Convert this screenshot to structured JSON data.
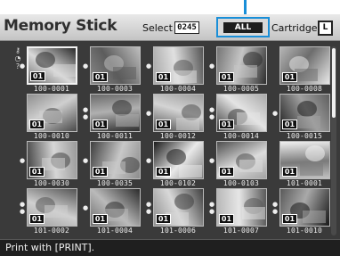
{
  "header": {
    "title": "Memory Stick",
    "select_label": "Select",
    "select_count": "0245",
    "all_label": "ALL",
    "cartridge_label": "Cartridge",
    "cartridge_icon_label": "L"
  },
  "side_icons": "◔ ? ?",
  "thumbnails": [
    {
      "name": "100-0001",
      "print_count": "01",
      "selected": true,
      "dots": 1,
      "palette": [
        "#6f6f6f",
        "#d9d9d9",
        "#2a2a2a"
      ]
    },
    {
      "name": "100-0003",
      "print_count": "01",
      "selected": false,
      "dots": 1,
      "palette": [
        "#8a8a8a",
        "#5c5c5c",
        "#bdbdbd"
      ]
    },
    {
      "name": "100-0004",
      "print_count": "01",
      "selected": false,
      "dots": 1,
      "palette": [
        "#a8a8a8",
        "#e0e0e0",
        "#555555"
      ]
    },
    {
      "name": "100-0005",
      "print_count": "01",
      "selected": false,
      "dots": 1,
      "palette": [
        "#767676",
        "#c5c5c5",
        "#2d2d2d"
      ]
    },
    {
      "name": "100-0008",
      "print_count": "01",
      "selected": false,
      "dots": 0,
      "palette": [
        "#b5b5b5",
        "#6d6d6d",
        "#e8e8e8"
      ]
    },
    {
      "name": "100-0010",
      "print_count": "01",
      "selected": false,
      "dots": 0,
      "palette": [
        "#8f8f8f",
        "#cfcfcf",
        "#4a4a4a"
      ]
    },
    {
      "name": "100-0011",
      "print_count": "01",
      "selected": false,
      "dots": 2,
      "palette": [
        "#6a6a6a",
        "#b0b0b0",
        "#2f2f2f"
      ]
    },
    {
      "name": "100-0012",
      "print_count": "01",
      "selected": false,
      "dots": 1,
      "palette": [
        "#9b9b9b",
        "#d4d4d4",
        "#505050"
      ]
    },
    {
      "name": "100-0014",
      "print_count": "01",
      "selected": false,
      "dots": 2,
      "palette": [
        "#aaaaaa",
        "#e4e4e4",
        "#3c3c3c"
      ]
    },
    {
      "name": "100-0015",
      "print_count": "01",
      "selected": false,
      "dots": 1,
      "palette": [
        "#5f5f5f",
        "#9f9f9f",
        "#1f1f1f"
      ]
    },
    {
      "name": "100-0030",
      "print_count": "01",
      "selected": false,
      "dots": 1,
      "palette": [
        "#9a9a9a",
        "#d6d6d6",
        "#444444"
      ]
    },
    {
      "name": "100-0035",
      "print_count": "01",
      "selected": false,
      "dots": 1,
      "palette": [
        "#8c8c8c",
        "#c8c8c8",
        "#3f3f3f"
      ]
    },
    {
      "name": "100-0102",
      "print_count": "01",
      "selected": false,
      "dots": 1,
      "palette": [
        "#7c7c7c",
        "#e9e9e9",
        "#1c1c1c"
      ]
    },
    {
      "name": "100-0103",
      "print_count": "01",
      "selected": false,
      "dots": 1,
      "palette": [
        "#a3a3a3",
        "#dcdcdc",
        "#4e4e4e"
      ]
    },
    {
      "name": "101-0001",
      "print_count": "01",
      "selected": false,
      "dots": 0,
      "palette": [
        "#c2c2c2",
        "#7a7a7a",
        "#f0f0f0"
      ]
    },
    {
      "name": "101-0002",
      "print_count": "01",
      "selected": false,
      "dots": 2,
      "palette": [
        "#9d9d9d",
        "#d0d0d0",
        "#555555"
      ]
    },
    {
      "name": "101-0004",
      "print_count": "01",
      "selected": false,
      "dots": 1,
      "palette": [
        "#6c6c6c",
        "#bababa",
        "#2b2b2b"
      ]
    },
    {
      "name": "101-0006",
      "print_count": "01",
      "selected": false,
      "dots": 2,
      "palette": [
        "#8e8e8e",
        "#d8d8d8",
        "#404040"
      ]
    },
    {
      "name": "101-0007",
      "print_count": "01",
      "selected": false,
      "dots": 2,
      "palette": [
        "#b8b8b8",
        "#e6e6e6",
        "#5a5a5a"
      ]
    },
    {
      "name": "101-0010",
      "print_count": "01",
      "selected": false,
      "dots": 2,
      "palette": [
        "#5a5a5a",
        "#a9a9a9",
        "#181818"
      ]
    }
  ],
  "footer": {
    "message": "Print with [PRINT]."
  },
  "colors": {
    "accent": "#1a8fd8",
    "screen_bg": "#3a3a3a",
    "header_bg": "#d4d4d4"
  }
}
